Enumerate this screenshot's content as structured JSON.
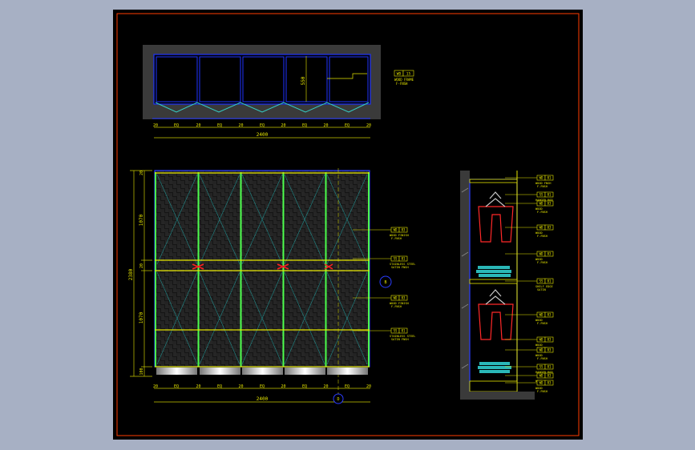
{
  "app": {
    "background_color": "#a7b0c4",
    "canvas_color": "#000000",
    "frame_color": "#ff3c00"
  },
  "plan_view": {
    "depth_dim": "550",
    "total_dim": "2400",
    "segments": [
      "20",
      "EQ",
      "20",
      "EQ",
      "20",
      "EQ",
      "20",
      "EQ",
      "20",
      "EQ",
      "20"
    ],
    "tag": {
      "code": "WD",
      "num": "15",
      "line1": "WOOD FRAME",
      "line2": "F-FNSH"
    }
  },
  "front_elevation": {
    "total_width_dim": "2400",
    "total_height_dim": "2380",
    "upper_height_dim": "1070",
    "lower_height_dim": "1070",
    "mid_dim": "20",
    "top_dim": "20",
    "base_dim": "100",
    "segments": [
      "20",
      "EQ",
      "20",
      "EQ",
      "20",
      "EQ",
      "20",
      "EQ",
      "20",
      "EQ",
      "20"
    ],
    "section_marker_right": "B",
    "section_marker_bottom": "D",
    "tags": [
      {
        "code": "WD",
        "num": "03",
        "line1": "WOOD FINISH",
        "line2": "F-FNSH"
      },
      {
        "code": "SS",
        "num": "01",
        "line1": "STAINLESS STEEL",
        "line2": "SATIN FNSH"
      },
      {
        "code": "WD",
        "num": "03",
        "line1": "WOOD FINISH",
        "line2": "F-FNSH"
      },
      {
        "code": "SS",
        "num": "01",
        "line1": "STAINLESS STEEL",
        "line2": "SATIN FNSH"
      }
    ]
  },
  "section_view": {
    "tags": [
      {
        "code": "WD",
        "num": "01",
        "line1": "WOOD FNSH",
        "line2": "F-FNSH"
      },
      {
        "code": "SS",
        "num": "01",
        "line1": "HANGER ROD",
        "line2": "SATIN"
      },
      {
        "code": "WD",
        "num": "03",
        "line1": "WOOD",
        "line2": "F-FNSH"
      },
      {
        "code": "WD",
        "num": "03",
        "line1": "WOOD",
        "line2": "F-FNSH"
      },
      {
        "code": "WD",
        "num": "03",
        "line1": "WOOD",
        "line2": "F-FNSH"
      },
      {
        "code": "SS",
        "num": "01",
        "line1": "SHELF EDGE",
        "line2": "SATIN"
      },
      {
        "code": "WD",
        "num": "03",
        "line1": "WOOD",
        "line2": "F-FNSH"
      },
      {
        "code": "WD",
        "num": "03",
        "line1": "WOOD",
        "line2": "F-FNSH"
      },
      {
        "code": "WD",
        "num": "03",
        "line1": "WOOD",
        "line2": "F-FNSH"
      },
      {
        "code": "SS",
        "num": "01",
        "line1": "HANGER ROD",
        "line2": "SATIN"
      },
      {
        "code": "WD",
        "num": "03",
        "line1": "WOOD",
        "line2": "F-FNSH"
      },
      {
        "code": "WD",
        "num": "03",
        "line1": "WOOD",
        "line2": "F-FNSH"
      }
    ]
  }
}
